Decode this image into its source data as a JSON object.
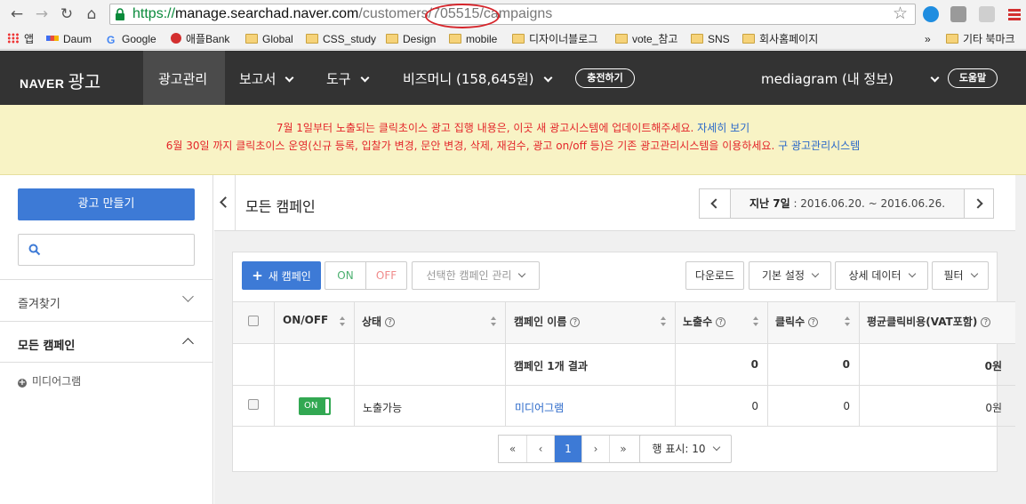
{
  "browser": {
    "url_scheme": "https://",
    "url_domain": "manage.searchad.naver.com",
    "url_path_1": "/customers/",
    "url_path_id": "705515",
    "url_path_2": "/campaigns",
    "nav_back_icon": "arrow-left-icon",
    "nav_forward_icon": "arrow-right-icon",
    "reload_icon": "reload-icon",
    "home_icon": "home-icon",
    "bookmarks": [
      "앱",
      "Daum",
      "Google",
      "애플Bank",
      "Global",
      "CSS_study",
      "Design",
      "mobile",
      "디자이너블로그",
      "vote_참고",
      "SNS",
      "회사홈페이지"
    ],
    "bookmarks_more": "»",
    "bookmarks_other": "기타 북마크"
  },
  "header": {
    "logo_naver": "NAVER",
    "logo_ko": "광고",
    "nav": [
      "광고관리",
      "보고서",
      "도구"
    ],
    "biz_money": "비즈머니 (158,645원)",
    "charge_button": "충전하기",
    "account": "mediagram (내 정보)",
    "help_button": "도움말"
  },
  "notice": {
    "line1_text": "7월 1일부터 노출되는 클릭초이스 광고 집행 내용은, 이곳 새 광고시스템에 업데이트해주세요.",
    "line1_link": "자세히 보기",
    "line2_text": "6월 30일 까지 클릭초이스 운영(신규 등록, 입찰가 변경, 문안 변경, 삭제, 재검수, 광고 on/off 등)은 기존 광고관리시스템을 이용하세요.",
    "line2_link": "구 광고관리시스템"
  },
  "sidebar": {
    "create_button": "광고 만들기",
    "search_placeholder": "",
    "favorites": "즐겨찾기",
    "all_campaigns": "모든 캠페인",
    "sub_item": "미디어그램"
  },
  "main": {
    "title": "모든 캠페인",
    "date_label": "지난 7일",
    "date_range": " : 2016.06.20. ~ 2016.06.26.",
    "toolbar": {
      "new_campaign": "새 캠페인",
      "on": "ON",
      "off": "OFF",
      "manage_selected": "선택한 캠페인 관리",
      "download": "다운로드",
      "default_settings": "기본 설정",
      "detail_data": "상세 데이터",
      "filter": "필터"
    },
    "table": {
      "headers": [
        "ON/OFF",
        "상태",
        "캠페인 이름",
        "노출수",
        "클릭수",
        "평균클릭비용(VAT포함)"
      ],
      "summary": {
        "name": "캠페인 1개 결과",
        "impressions": "0",
        "clicks": "0",
        "avg_cpc": "0원"
      },
      "rows": [
        {
          "toggle": "ON",
          "status": "노출가능",
          "name": "미디어그램",
          "impressions": "0",
          "clicks": "0",
          "avg_cpc": "0원"
        }
      ]
    },
    "pagination": {
      "first": "«",
      "prev": "‹",
      "current": "1",
      "next": "›",
      "last": "»",
      "rows_label": "행 표시: 10"
    }
  },
  "colors": {
    "header_bg": "#333333",
    "accent": "#3d7ad6",
    "notice_bg": "#f8f3c5",
    "notice_text": "#e3262a",
    "link": "#2a68c9",
    "on_green": "#32a852"
  }
}
